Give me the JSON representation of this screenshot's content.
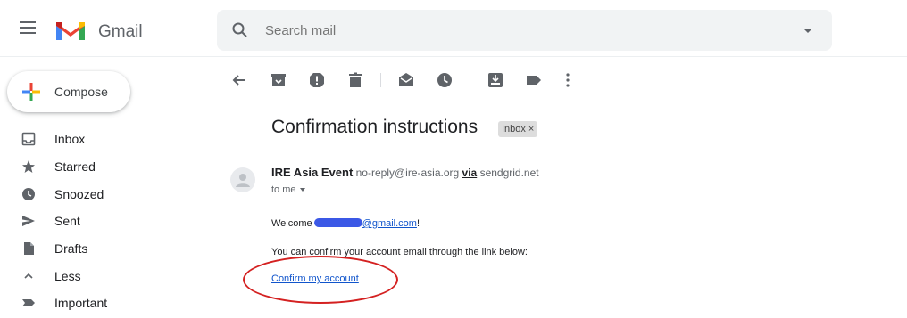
{
  "app": {
    "name": "Gmail"
  },
  "search": {
    "placeholder": "Search mail"
  },
  "compose": {
    "label": "Compose"
  },
  "sidebar": {
    "items": [
      {
        "label": "Inbox",
        "icon": "inbox-icon"
      },
      {
        "label": "Starred",
        "icon": "star-icon"
      },
      {
        "label": "Snoozed",
        "icon": "clock-icon"
      },
      {
        "label": "Sent",
        "icon": "send-icon"
      },
      {
        "label": "Drafts",
        "icon": "draft-icon"
      },
      {
        "label": "Less",
        "icon": "chevron-up-icon"
      },
      {
        "label": "Important",
        "icon": "important-icon"
      }
    ]
  },
  "toolbar": {
    "icons": [
      "back-arrow-icon",
      "archive-icon",
      "report-spam-icon",
      "delete-icon",
      "mark-unread-icon",
      "snooze-icon",
      "move-to-icon",
      "label-icon",
      "more-vert-icon"
    ]
  },
  "email": {
    "subject": "Confirmation instructions",
    "label_chip": "Inbox",
    "label_chip_close": "×",
    "sender_name": "IRE Asia Event",
    "sender_address": "no-reply@ire-asia.org",
    "via_label": "via",
    "via_domain": "sendgrid.net",
    "to": "to me",
    "greeting_prefix": "Welcome",
    "greeting_email_suffix": "@gmail.com",
    "greeting_end": "!",
    "body_text": "You can confirm your account email through the link below:",
    "confirm_link": "Confirm my account"
  },
  "colors": {
    "link": "#1155cc",
    "annotation_circle": "#d42121",
    "redaction": "#3b58e6"
  }
}
